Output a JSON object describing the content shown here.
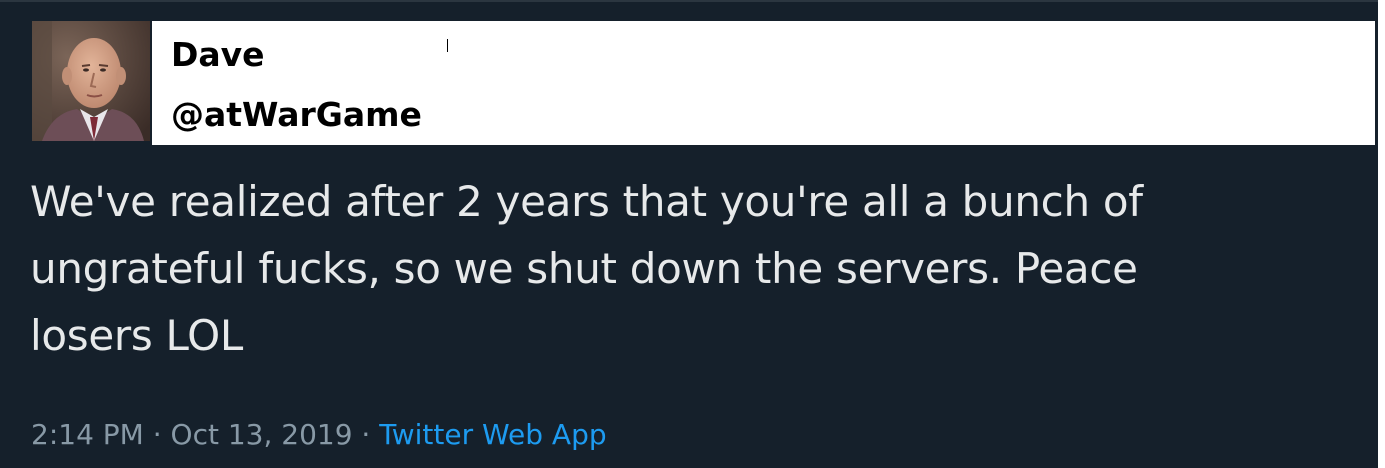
{
  "user": {
    "display_name": "Dave",
    "handle": "@atWarGame"
  },
  "tweet": {
    "text": "We've realized after 2 years that you're all a bunch of\nungrateful fucks, so we shut down the servers. Peace\nlosers LOL"
  },
  "meta": {
    "time": "2:14 PM",
    "separator_1": " · ",
    "date": "Oct 13, 2019",
    "separator_2": " · ",
    "source": "Twitter Web App"
  },
  "colors": {
    "background": "#15202b",
    "text": "#e7e9ea",
    "meta": "#8899a6",
    "link": "#1d9bf0"
  },
  "icons": {
    "avatar": "profile-photo-avatar"
  }
}
